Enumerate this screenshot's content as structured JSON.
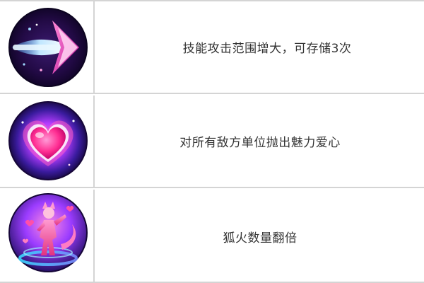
{
  "skills": [
    {
      "icon": "dash-arrow-icon",
      "description": "技能攻击范围增大，可存储3次",
      "accent": "#ff3fb0"
    },
    {
      "icon": "charm-heart-icon",
      "description": "对所有敌方单位抛出魅力爱心",
      "accent": "#ff2a8a"
    },
    {
      "icon": "fox-fire-icon",
      "description": "狐火数量翻倍",
      "accent": "#b64cff"
    }
  ],
  "colors": {
    "border": "#d4d4d4",
    "text": "#333333"
  }
}
